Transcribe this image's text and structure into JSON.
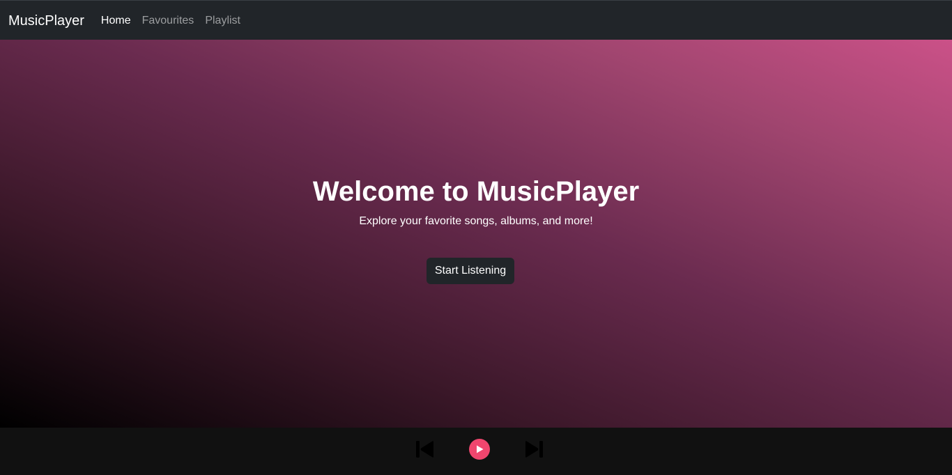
{
  "navbar": {
    "brand": "MusicPlayer",
    "links": [
      {
        "label": "Home",
        "active": true
      },
      {
        "label": "Favourites",
        "active": false
      },
      {
        "label": "Playlist",
        "active": false
      }
    ]
  },
  "hero": {
    "title": "Welcome to MusicPlayer",
    "subtitle": "Explore your favorite songs, albums, and more!",
    "cta_label": "Start Listening"
  },
  "player": {
    "prev_icon": "skip-previous-icon",
    "play_icon": "play-icon",
    "next_icon": "skip-next-icon"
  },
  "colors": {
    "navbar_bg": "#212529",
    "player_bg": "#111111",
    "accent": "#f0466e",
    "gradient_start": "#000000",
    "gradient_end": "#cb5188"
  }
}
